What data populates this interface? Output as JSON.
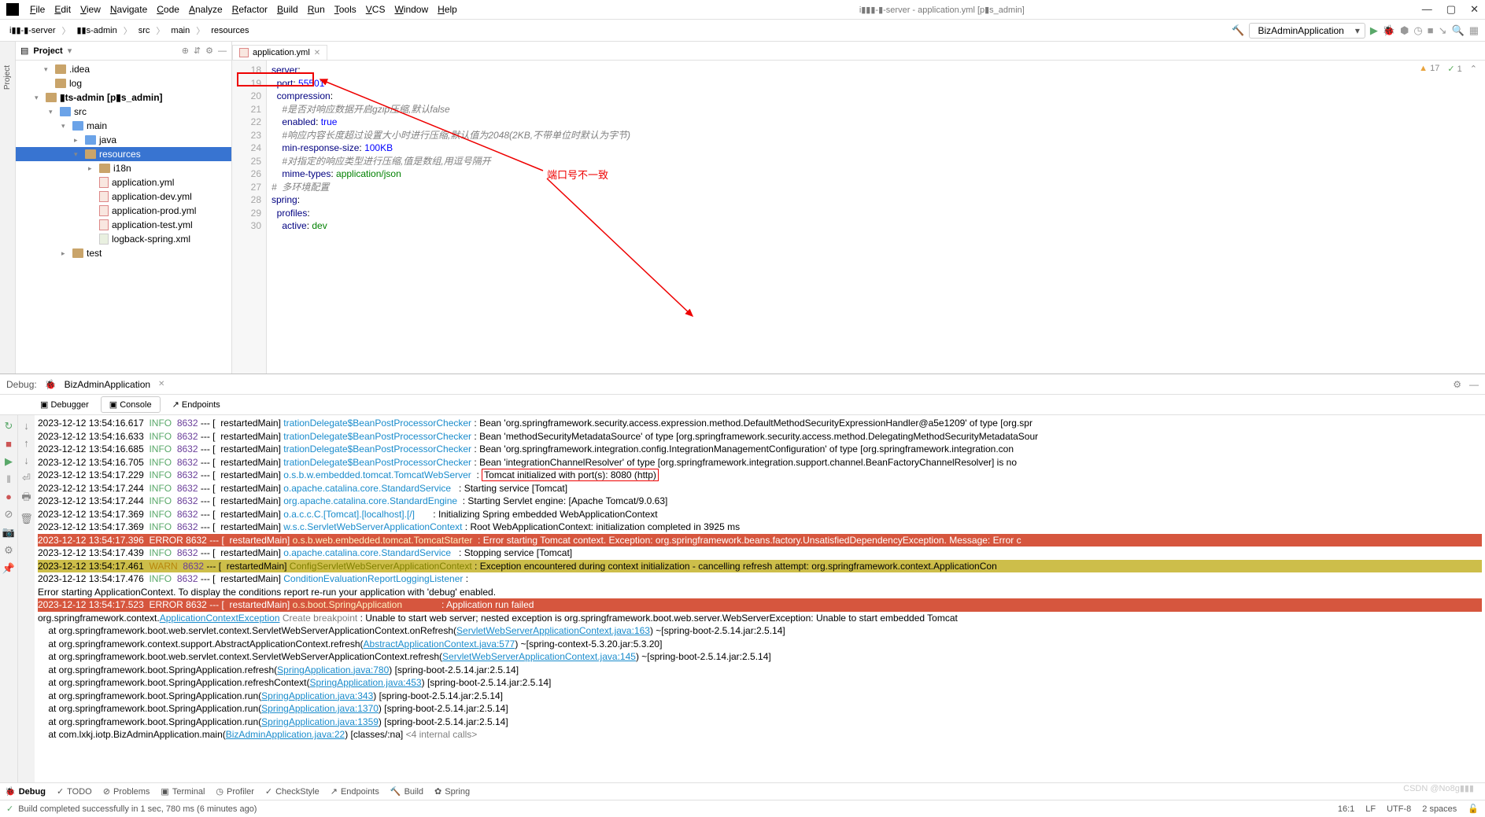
{
  "window": {
    "title": "i▮▮▮-▮-server - application.yml [p▮s_admin]"
  },
  "menu": [
    "File",
    "Edit",
    "View",
    "Navigate",
    "Code",
    "Analyze",
    "Refactor",
    "Build",
    "Run",
    "Tools",
    "VCS",
    "Window",
    "Help"
  ],
  "breadcrumb": [
    "i▮▮-▮-server",
    "▮▮s-admin",
    "src",
    "main",
    "resources"
  ],
  "runConfig": "BizAdminApplication",
  "projectPanel": {
    "title": "Project",
    "tree": [
      {
        "ind": 36,
        "exp": "▾",
        "icon": "dir",
        "label": ".idea"
      },
      {
        "ind": 36,
        "exp": "",
        "icon": "dir",
        "label": "log"
      },
      {
        "ind": 24,
        "exp": "▾",
        "icon": "dir",
        "label": "▮ts-admin [p▮s_admin]",
        "bold": true
      },
      {
        "ind": 42,
        "exp": "▾",
        "icon": "dir-blue",
        "label": "src"
      },
      {
        "ind": 58,
        "exp": "▾",
        "icon": "dir-blue",
        "label": "main"
      },
      {
        "ind": 74,
        "exp": "▸",
        "icon": "dir-blue",
        "label": "java"
      },
      {
        "ind": 74,
        "exp": "▾",
        "icon": "dir",
        "label": "resources",
        "sel": true
      },
      {
        "ind": 92,
        "exp": "▸",
        "icon": "dir",
        "label": "i18n"
      },
      {
        "ind": 92,
        "exp": "",
        "icon": "yml",
        "label": "application.yml"
      },
      {
        "ind": 92,
        "exp": "",
        "icon": "yml",
        "label": "application-dev.yml"
      },
      {
        "ind": 92,
        "exp": "",
        "icon": "yml",
        "label": "application-prod.yml"
      },
      {
        "ind": 92,
        "exp": "",
        "icon": "yml",
        "label": "application-test.yml"
      },
      {
        "ind": 92,
        "exp": "",
        "icon": "xml",
        "label": "logback-spring.xml"
      },
      {
        "ind": 58,
        "exp": "▸",
        "icon": "dir",
        "label": "test"
      }
    ]
  },
  "editor": {
    "tab": "application.yml",
    "startLine": 18,
    "lines": [
      [
        [
          "kw",
          "server"
        ],
        [
          "",
          ":"
        ]
      ],
      [
        [
          "",
          "  "
        ],
        [
          "kw",
          "port"
        ],
        [
          "",
          ": "
        ],
        [
          "num",
          "55501"
        ]
      ],
      [
        [
          "",
          "  "
        ],
        [
          "kw",
          "compression"
        ],
        [
          "",
          ":"
        ]
      ],
      [
        [
          "",
          "    "
        ],
        [
          "cmt",
          "#是否对响应数据开启gzip压缩,默认false"
        ]
      ],
      [
        [
          "",
          "    "
        ],
        [
          "kw",
          "enabled"
        ],
        [
          "",
          ": "
        ],
        [
          "num",
          "true"
        ]
      ],
      [
        [
          "",
          "    "
        ],
        [
          "cmt",
          "#响应内容长度超过设置大小时进行压缩,默认值为2048(2KB,不带单位时默认为字节)"
        ]
      ],
      [
        [
          "",
          "    "
        ],
        [
          "kw",
          "min-response-size"
        ],
        [
          "",
          ": "
        ],
        [
          "num",
          "100KB"
        ]
      ],
      [
        [
          "",
          "    "
        ],
        [
          "cmt",
          "#对指定的响应类型进行压缩,值是数组,用逗号隔开"
        ]
      ],
      [
        [
          "",
          "    "
        ],
        [
          "kw",
          "mime-types"
        ],
        [
          "",
          ": "
        ],
        [
          "str",
          "application/json"
        ]
      ],
      [
        [
          "cmt",
          "#  多环境配置"
        ]
      ],
      [
        [
          "kw",
          "spring"
        ],
        [
          "",
          ":"
        ]
      ],
      [
        [
          "",
          "  "
        ],
        [
          "kw",
          "profiles"
        ],
        [
          "",
          ":"
        ]
      ],
      [
        [
          "",
          "    "
        ],
        [
          "kw",
          "active"
        ],
        [
          "",
          ": "
        ],
        [
          "str",
          "dev"
        ]
      ]
    ],
    "warnings": "17",
    "checks": "1"
  },
  "annotation": {
    "text": "端口号不一致"
  },
  "debug": {
    "title": "Debug:",
    "app": "BizAdminApplication",
    "tabs": [
      "Debugger",
      "Console",
      "Endpoints"
    ],
    "activeTab": 1
  },
  "console": [
    {
      "ts": "2023-12-12 13:54:16.617",
      "lvl": "INFO",
      "pid": "8632",
      "thread": "restartedMain",
      "logger": "trationDelegate$BeanPostProcessorChecker",
      "msg": "Bean 'org.springframework.security.access.expression.method.DefaultMethodSecurityExpressionHandler@a5e1209' of type [org.spr"
    },
    {
      "ts": "2023-12-12 13:54:16.633",
      "lvl": "INFO",
      "pid": "8632",
      "thread": "restartedMain",
      "logger": "trationDelegate$BeanPostProcessorChecker",
      "msg": "Bean 'methodSecurityMetadataSource' of type [org.springframework.security.access.method.DelegatingMethodSecurityMetadataSour"
    },
    {
      "ts": "2023-12-12 13:54:16.685",
      "lvl": "INFO",
      "pid": "8632",
      "thread": "restartedMain",
      "logger": "trationDelegate$BeanPostProcessorChecker",
      "msg": "Bean 'org.springframework.integration.config.IntegrationManagementConfiguration' of type [org.springframework.integration.con"
    },
    {
      "ts": "2023-12-12 13:54:16.705",
      "lvl": "INFO",
      "pid": "8632",
      "thread": "restartedMain",
      "logger": "trationDelegate$BeanPostProcessorChecker",
      "msg": "Bean 'integrationChannelResolver' of type [org.springframework.integration.support.channel.BeanFactoryChannelResolver] is no"
    },
    {
      "ts": "2023-12-12 13:54:17.229",
      "lvl": "INFO",
      "pid": "8632",
      "thread": "restartedMain",
      "logger": "o.s.b.w.embedded.tomcat.TomcatWebServer",
      "msg": "Tomcat initialized with port(s): 8080 (http)",
      "box": true
    },
    {
      "ts": "2023-12-12 13:54:17.244",
      "lvl": "INFO",
      "pid": "8632",
      "thread": "restartedMain",
      "logger": "o.apache.catalina.core.StandardService",
      "msg": "Starting service [Tomcat]"
    },
    {
      "ts": "2023-12-12 13:54:17.244",
      "lvl": "INFO",
      "pid": "8632",
      "thread": "restartedMain",
      "logger": "org.apache.catalina.core.StandardEngine",
      "msg": "Starting Servlet engine: [Apache Tomcat/9.0.63]"
    },
    {
      "ts": "2023-12-12 13:54:17.369",
      "lvl": "INFO",
      "pid": "8632",
      "thread": "restartedMain",
      "logger": "o.a.c.c.C.[Tomcat].[localhost].[/]",
      "msg": "Initializing Spring embedded WebApplicationContext"
    },
    {
      "ts": "2023-12-12 13:54:17.369",
      "lvl": "INFO",
      "pid": "8632",
      "thread": "restartedMain",
      "logger": "w.s.c.ServletWebServerApplicationContext",
      "msg": "Root WebApplicationContext: initialization completed in 3925 ms"
    },
    {
      "ts": "2023-12-12 13:54:17.396",
      "lvl": "ERROR",
      "pid": "8632",
      "thread": "restartedMain",
      "logger": "o.s.b.web.embedded.tomcat.TomcatStarter",
      "msg": "Error starting Tomcat context. Exception: org.springframework.beans.factory.UnsatisfiedDependencyException. Message: Error c",
      "row": "err"
    },
    {
      "ts": "2023-12-12 13:54:17.439",
      "lvl": "INFO",
      "pid": "8632",
      "thread": "restartedMain",
      "logger": "o.apache.catalina.core.StandardService",
      "msg": "Stopping service [Tomcat]"
    },
    {
      "ts": "2023-12-12 13:54:17.461",
      "lvl": "WARN",
      "pid": "8632",
      "thread": "restartedMain",
      "logger": "ConfigServletWebServerApplicationContext",
      "msg": "Exception encountered during context initialization - cancelling refresh attempt: org.springframework.context.ApplicationCon",
      "row": "warn"
    },
    {
      "ts": "2023-12-12 13:54:17.476",
      "lvl": "INFO",
      "pid": "8632",
      "thread": "restartedMain",
      "logger": "ConditionEvaluationReportLoggingListener",
      "msg": ""
    },
    {
      "raw": ""
    },
    {
      "raw": "Error starting ApplicationContext. To display the conditions report re-run your application with 'debug' enabled."
    },
    {
      "ts": "2023-12-12 13:54:17.523",
      "lvl": "ERROR",
      "pid": "8632",
      "thread": "restartedMain",
      "logger": "o.s.boot.SpringApplication",
      "msg": "Application run failed",
      "row": "err"
    },
    {
      "raw": ""
    },
    {
      "stack": "org.springframework.context.",
      "link": "ApplicationContextException",
      "bp": " Create breakpoint ",
      "tail": ": Unable to start web server; nested exception is org.springframework.boot.web.server.WebServerException: Unable to start embedded Tomcat"
    },
    {
      "stack": "    at org.springframework.boot.web.servlet.context.ServletWebServerApplicationContext.onRefresh(",
      "link": "ServletWebServerApplicationContext.java:163",
      "tail": ") ~[spring-boot-2.5.14.jar:2.5.14]"
    },
    {
      "stack": "    at org.springframework.context.support.AbstractApplicationContext.refresh(",
      "link": "AbstractApplicationContext.java:577",
      "tail": ") ~[spring-context-5.3.20.jar:5.3.20]"
    },
    {
      "stack": "    at org.springframework.boot.web.servlet.context.ServletWebServerApplicationContext.refresh(",
      "link": "ServletWebServerApplicationContext.java:145",
      "tail": ") ~[spring-boot-2.5.14.jar:2.5.14]"
    },
    {
      "stack": "    at org.springframework.boot.SpringApplication.refresh(",
      "link": "SpringApplication.java:780",
      "tail": ") [spring-boot-2.5.14.jar:2.5.14]"
    },
    {
      "stack": "    at org.springframework.boot.SpringApplication.refreshContext(",
      "link": "SpringApplication.java:453",
      "tail": ") [spring-boot-2.5.14.jar:2.5.14]"
    },
    {
      "stack": "    at org.springframework.boot.SpringApplication.run(",
      "link": "SpringApplication.java:343",
      "tail": ") [spring-boot-2.5.14.jar:2.5.14]"
    },
    {
      "stack": "    at org.springframework.boot.SpringApplication.run(",
      "link": "SpringApplication.java:1370",
      "tail": ") [spring-boot-2.5.14.jar:2.5.14]"
    },
    {
      "stack": "    at org.springframework.boot.SpringApplication.run(",
      "link": "SpringApplication.java:1359",
      "tail": ") [spring-boot-2.5.14.jar:2.5.14]"
    },
    {
      "stack": "    at com.lxkj.iotp.BizAdminApplication.main(",
      "link": "BizAdminApplication.java:22",
      "tail": ") [classes/:na] ",
      "calls": "<4 internal calls>"
    }
  ],
  "toolStrip": [
    {
      "icon": "🐞",
      "label": "Debug",
      "active": true
    },
    {
      "icon": "✓",
      "label": "TODO"
    },
    {
      "icon": "⊘",
      "label": "Problems"
    },
    {
      "icon": "▣",
      "label": "Terminal"
    },
    {
      "icon": "◷",
      "label": "Profiler"
    },
    {
      "icon": "✓",
      "label": "CheckStyle"
    },
    {
      "icon": "↗",
      "label": "Endpoints"
    },
    {
      "icon": "🔨",
      "label": "Build"
    },
    {
      "icon": "✿",
      "label": "Spring"
    }
  ],
  "statusbar": {
    "msg": "Build completed successfully in 1 sec, 780 ms (6 minutes ago)",
    "pos": "16:1",
    "lf": "LF",
    "enc": "UTF-8",
    "indent": "2 spaces"
  },
  "watermark": "CSDN @No8g▮▮▮"
}
